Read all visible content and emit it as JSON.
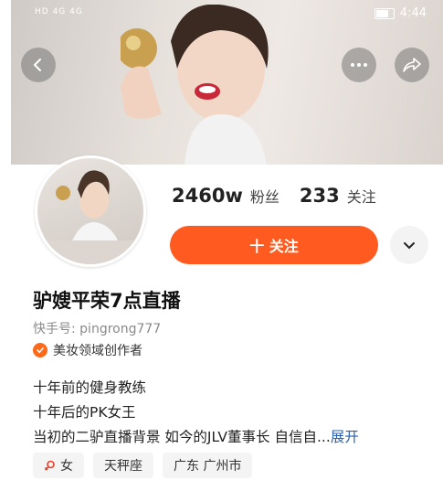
{
  "status_bar": {
    "network_label": "HD 4G 4G",
    "time": "4:44"
  },
  "header": {
    "back_icon": "chevron-left-icon",
    "more_icon": "ellipsis-icon",
    "share_icon": "share-arrow-icon"
  },
  "profile": {
    "followers_count": "2460w",
    "followers_label": "粉丝",
    "following_count": "233",
    "following_label": "关注",
    "follow_button_label": "十 关注",
    "name": "驴嫂平荣7点直播",
    "kuaishou_id": "快手号: pingrong777",
    "creator_label": "美妆领域创作者",
    "bio_lines": [
      "十年前的健身教练",
      "十年后的PK女王",
      "当初的二驴直播背景 如今的JLV董事长 自信自..."
    ],
    "expand_label": "展开",
    "tags": [
      "女",
      "天秤座",
      "广东 广州市"
    ]
  },
  "colors": {
    "accent": "#ff5a1f",
    "link": "#2a5fb0",
    "gender_icon": "#e8412c"
  }
}
